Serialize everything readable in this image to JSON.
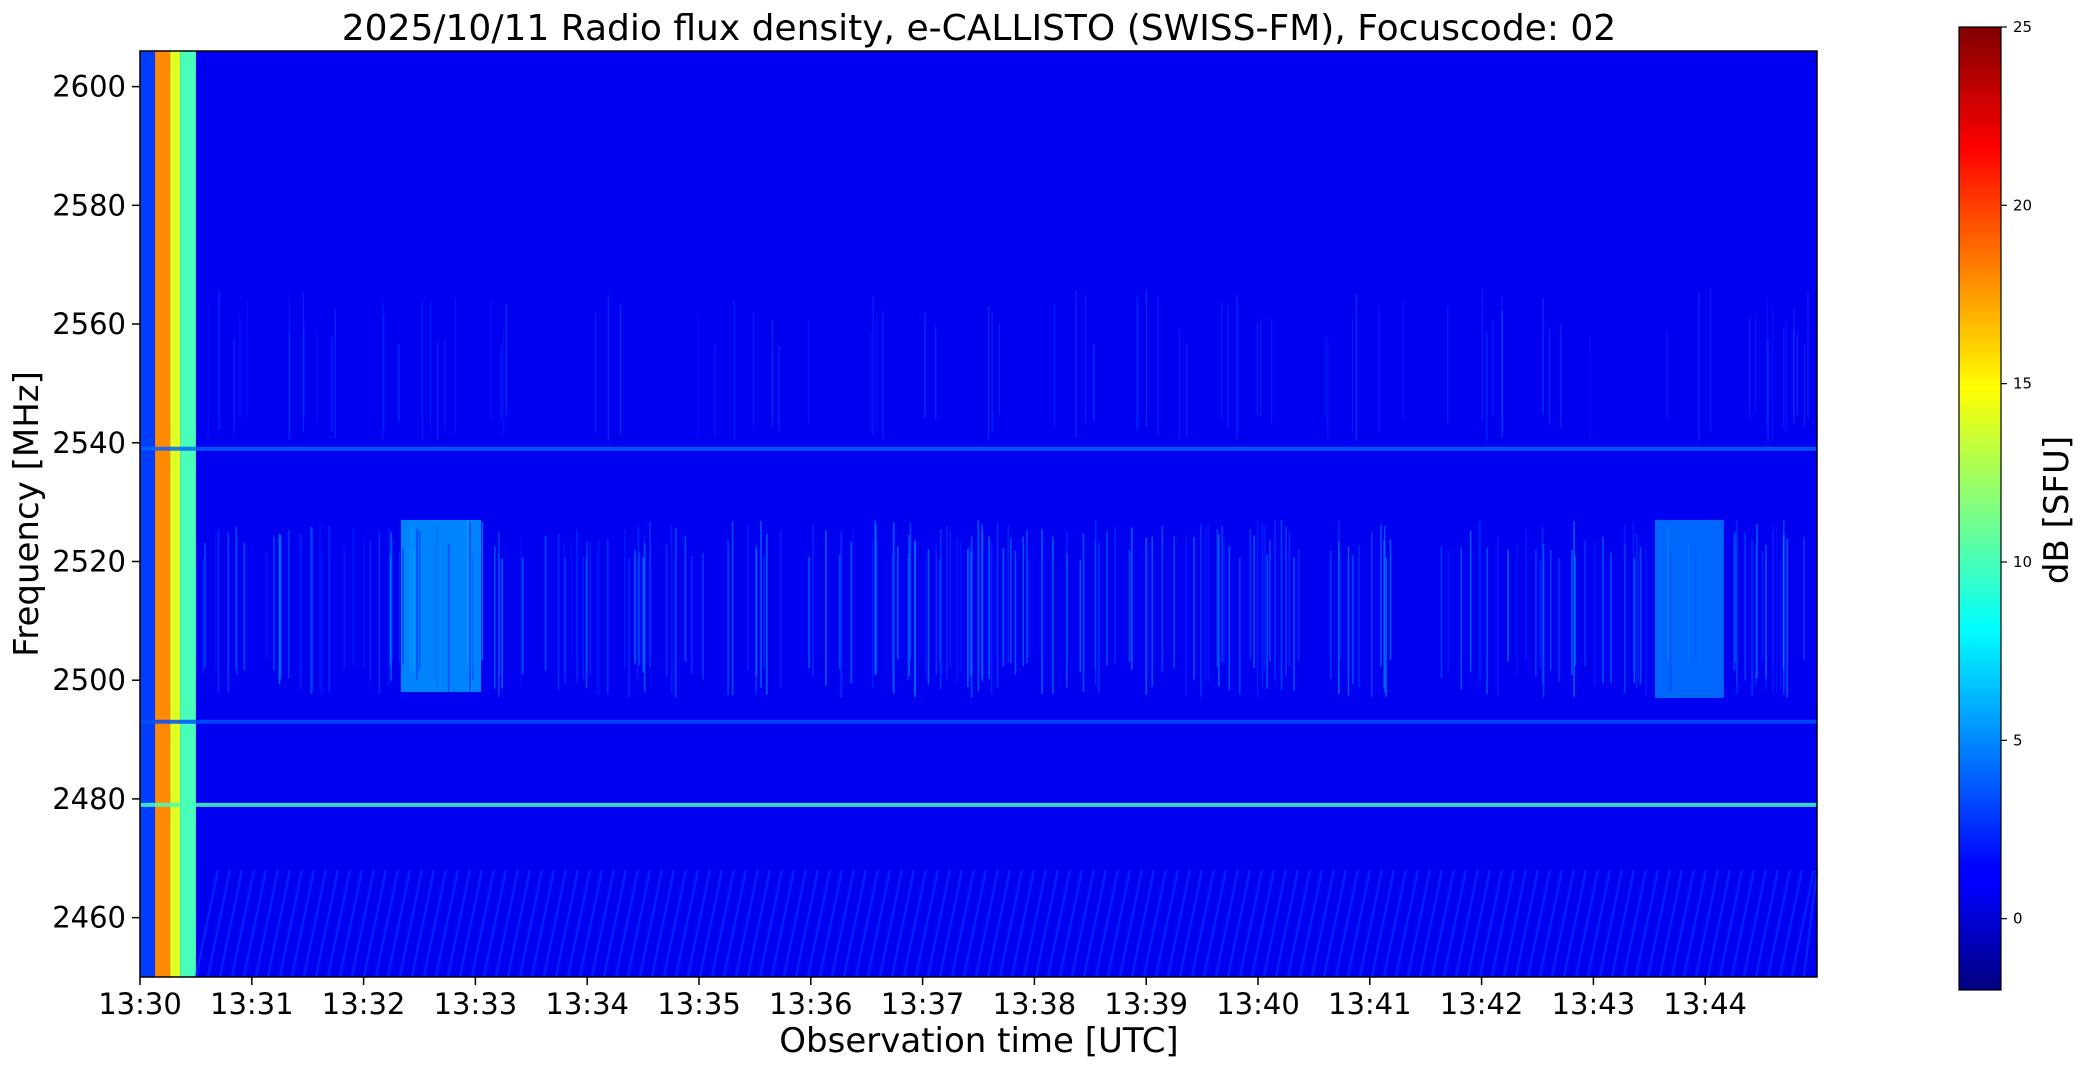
{
  "chart_data": {
    "type": "heatmap",
    "title": "2025/10/11  Radio flux density, e-CALLISTO (SWISS-FM), Focuscode: 02",
    "xlabel": "Observation time [UTC]",
    "ylabel": "Frequency [MHz]",
    "colorbar_label": "dB [SFU]",
    "colormap": "jet",
    "x_range": [
      "13:30:00",
      "13:45:00"
    ],
    "x_ticks": [
      "13:30",
      "13:31",
      "13:32",
      "13:33",
      "13:34",
      "13:35",
      "13:36",
      "13:37",
      "13:38",
      "13:39",
      "13:40",
      "13:41",
      "13:42",
      "13:43",
      "13:44"
    ],
    "ylim": [
      2450,
      2606
    ],
    "y_ticks": [
      2460,
      2480,
      2500,
      2520,
      2540,
      2560,
      2580,
      2600
    ],
    "colorbar_range": [
      -2,
      25
    ],
    "colorbar_ticks": [
      0,
      5,
      10,
      15,
      20,
      25
    ],
    "background_level_db": 1,
    "features": [
      {
        "kind": "calibration_band",
        "t_start": "13:30:00",
        "t_end": "13:30:30",
        "f_min": 2450,
        "f_max": 2606,
        "level_db": 15
      },
      {
        "kind": "narrowband_line",
        "freq_mhz": 2479,
        "level_db": 10
      },
      {
        "kind": "narrowband_line",
        "freq_mhz": 2539,
        "level_db": 4
      },
      {
        "kind": "narrowband_line",
        "freq_mhz": 2493,
        "level_db": 3.5
      },
      {
        "kind": "broadband_patch",
        "t_start": "13:32:20",
        "t_end": "13:33:03",
        "f_min": 2498,
        "f_max": 2527,
        "level_db": 6
      },
      {
        "kind": "broadband_patch",
        "t_start": "13:43:33",
        "t_end": "13:44:10",
        "f_min": 2497,
        "f_max": 2527,
        "level_db": 5
      },
      {
        "kind": "diagonal_striations",
        "t_start": "13:30:30",
        "t_end": "13:45:00",
        "f_min": 2450,
        "f_max": 2468,
        "level_db": 3
      }
    ]
  }
}
